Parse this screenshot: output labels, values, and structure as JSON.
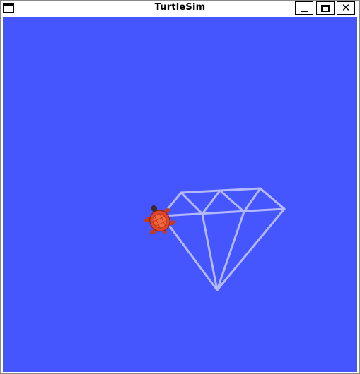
{
  "window": {
    "title": "TurtleSim",
    "controls": {
      "minimize_icon": "minimize-icon",
      "maximize_icon": "maximize-icon",
      "close_icon": "close-icon",
      "close_glyph": "✕"
    }
  },
  "canvas": {
    "background_color": "#4556ff",
    "pen_color": "#b3b8ff",
    "drawing": "diamond-outline",
    "turtle_color": "#e0452b"
  }
}
